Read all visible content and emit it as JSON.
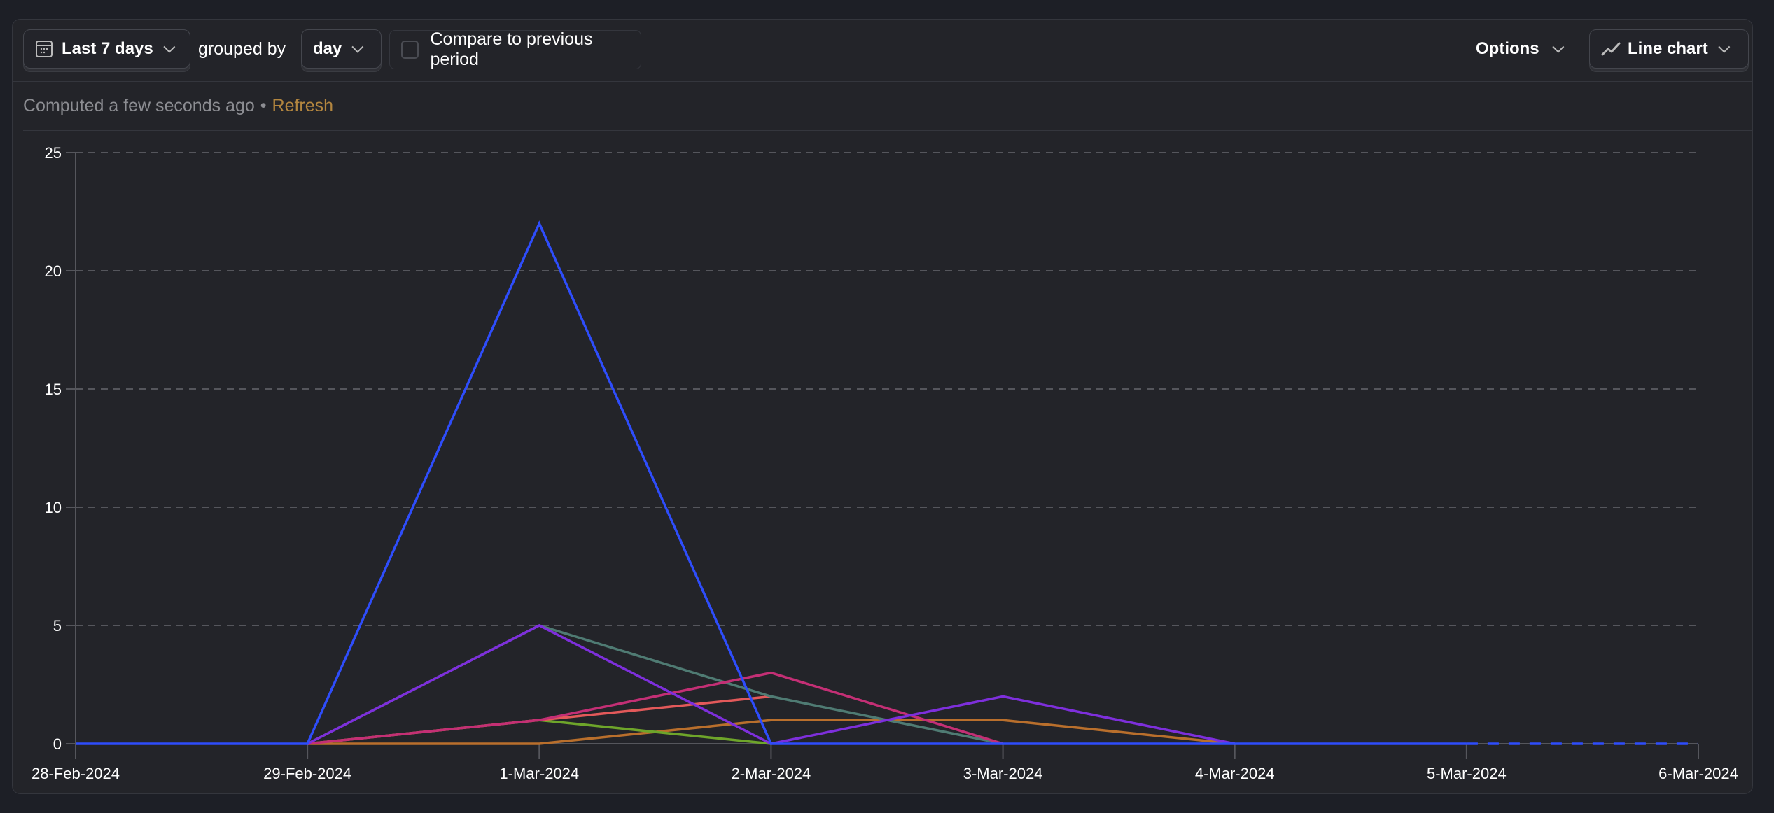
{
  "toolbar": {
    "date_range": "Last 7 days",
    "grouped_by_label": "grouped by",
    "interval": "day",
    "compare_label": "Compare to previous period",
    "compare_checked": false,
    "options_label": "Options",
    "chart_type_label": "Line chart"
  },
  "status": {
    "computed": "Computed a few seconds ago",
    "separator": "•",
    "refresh_label": "Refresh",
    "refresh_color": "#b3863f"
  },
  "chart_data": {
    "type": "line",
    "title": "",
    "xlabel": "",
    "ylabel": "",
    "ylim": [
      0,
      25
    ],
    "yticks": [
      0,
      5,
      10,
      15,
      20,
      25
    ],
    "grid": true,
    "legend": "none",
    "x": [
      "28-Feb-2024",
      "29-Feb-2024",
      "1-Mar-2024",
      "2-Mar-2024",
      "3-Mar-2024",
      "4-Mar-2024",
      "5-Mar-2024",
      "6-Mar-2024"
    ],
    "series": [
      {
        "name": "series-orange",
        "color": "#b96f2c",
        "values": [
          null,
          0,
          0,
          1,
          1,
          0,
          null,
          null
        ]
      },
      {
        "name": "series-green",
        "color": "#6ea52a",
        "values": [
          null,
          0,
          1,
          0,
          null,
          null,
          null,
          null
        ]
      },
      {
        "name": "series-red",
        "color": "#e3595a",
        "values": [
          null,
          0,
          1,
          2,
          null,
          null,
          null,
          null
        ]
      },
      {
        "name": "series-teal",
        "color": "#4f7b73",
        "values": [
          null,
          0,
          5,
          2,
          0,
          null,
          null,
          null
        ]
      },
      {
        "name": "series-magenta",
        "color": "#c42f75",
        "values": [
          null,
          0,
          1,
          3,
          0,
          null,
          null,
          null
        ]
      },
      {
        "name": "series-purple",
        "color": "#7e2fdc",
        "values": [
          null,
          0,
          5,
          0,
          2,
          0,
          null,
          null
        ]
      },
      {
        "name": "series-blue",
        "color": "#2e4dfb",
        "values": [
          0,
          0,
          22,
          0,
          0,
          0,
          0,
          0
        ],
        "dashed_from_index": 6
      }
    ]
  }
}
